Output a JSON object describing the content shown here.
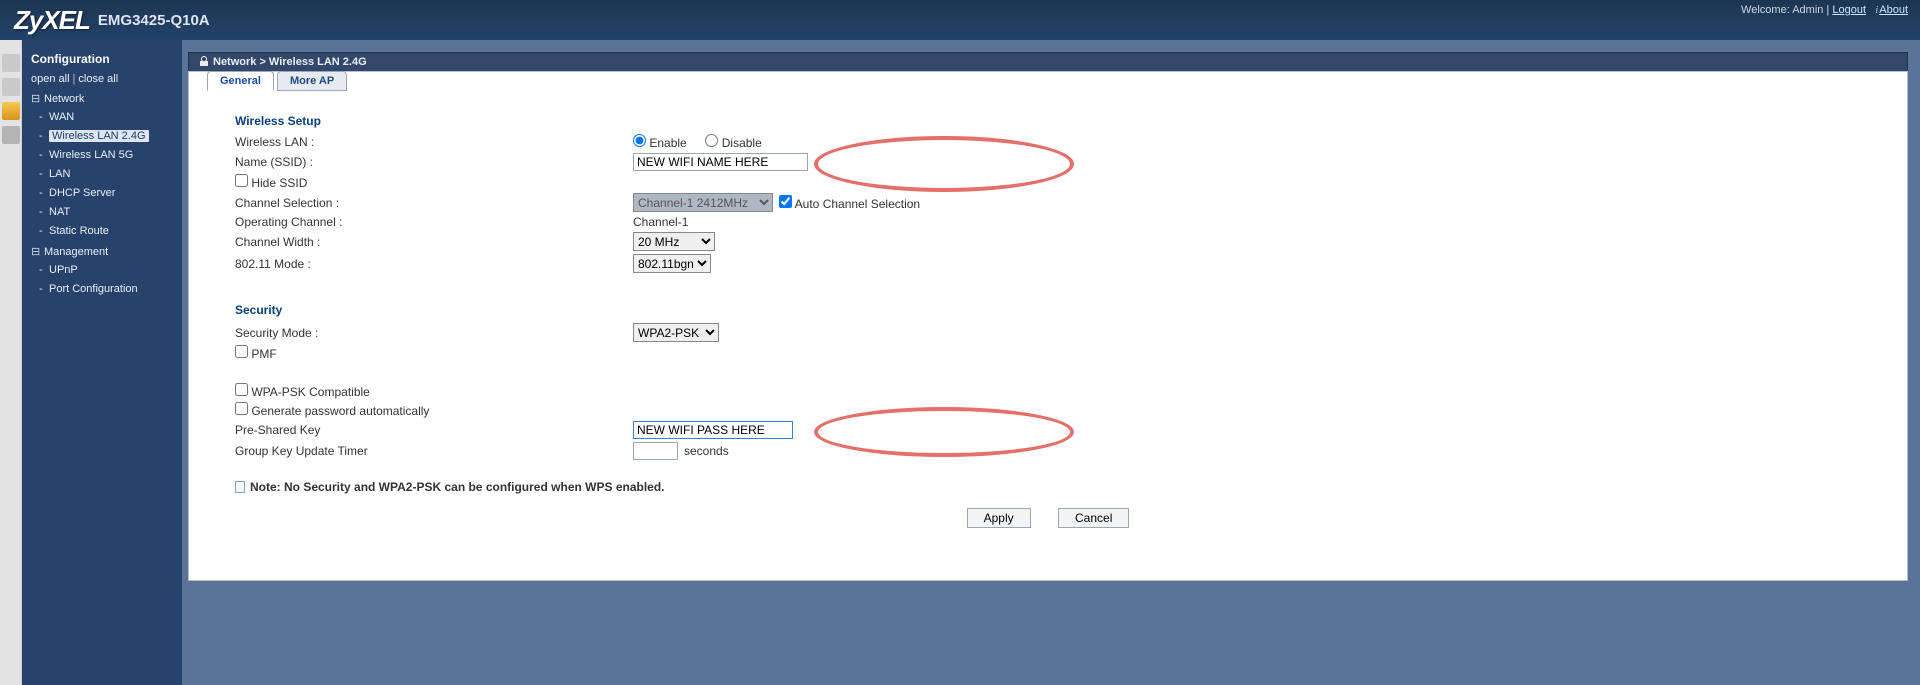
{
  "top": {
    "brand": "ZyXEL",
    "model": "EMG3425-Q10A",
    "welcome": "Welcome: Admin |",
    "logout": "Logout",
    "about": "About"
  },
  "sidebar": {
    "title": "Configuration",
    "openall": "open all",
    "closeall": "close all",
    "groups": [
      {
        "name": "Network",
        "items": [
          "WAN",
          "Wireless LAN 2.4G",
          "Wireless LAN 5G",
          "LAN",
          "DHCP Server",
          "NAT",
          "Static Route"
        ],
        "selected": 1
      },
      {
        "name": "Management",
        "items": [
          "UPnP",
          "Port Configuration"
        ],
        "selected": -1
      }
    ]
  },
  "crumb": "Network > Wireless LAN 2.4G",
  "tabs": [
    "General",
    "More AP"
  ],
  "sections": {
    "wireless_setup": "Wireless Setup",
    "security": "Security"
  },
  "labels": {
    "wlan": "Wireless LAN :",
    "enable": "Enable",
    "disable": "Disable",
    "ssid": "Name (SSID) :",
    "hide_ssid": "Hide SSID",
    "chan_sel": "Channel Selection :",
    "auto_chan": "Auto Channel Selection",
    "op_chan": "Operating Channel :",
    "chan_width": "Channel Width :",
    "mode": "802.11 Mode :",
    "sec_mode": "Security Mode :",
    "pmf": "PMF",
    "wpa_comp": "WPA-PSK Compatible",
    "gen_pwd": "Generate password automatically",
    "psk": "Pre-Shared Key",
    "gkt": "Group Key Update Timer",
    "seconds": "seconds"
  },
  "values": {
    "wlan_enable": true,
    "ssid": "NEW WIFI NAME HERE",
    "chan_sel": "Channel-1 2412MHz",
    "auto_chan": true,
    "op_chan": "Channel-1",
    "chan_width": "20 MHz",
    "mode": "802.11bgn",
    "sec_mode": "WPA2-PSK",
    "pmf": false,
    "wpa_comp": false,
    "gen_pwd": false,
    "psk": "NEW WIFI PASS HERE",
    "gkt": ""
  },
  "note": "Note: No Security and WPA2-PSK can be configured when WPS enabled.",
  "buttons": {
    "apply": "Apply",
    "cancel": "Cancel"
  }
}
